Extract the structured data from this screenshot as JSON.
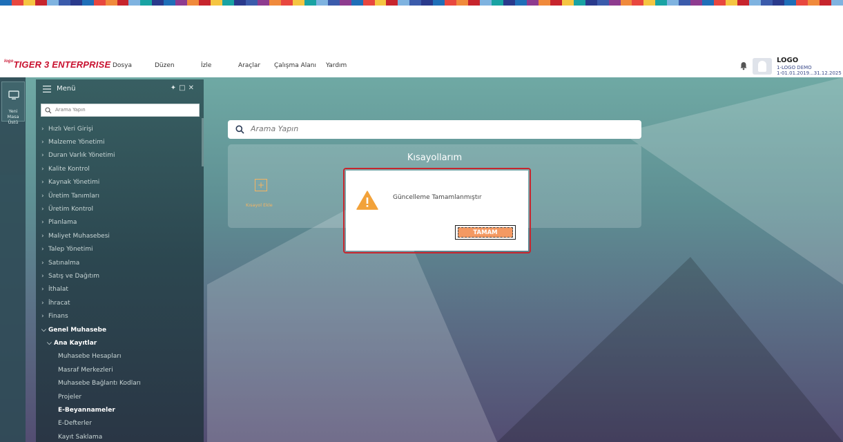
{
  "app": {
    "brand_prefix": "logo",
    "brand": "TIGER 3 ENTERPRISE"
  },
  "menubar": {
    "items": [
      {
        "label": "Dosya"
      },
      {
        "label": "Düzen"
      },
      {
        "label": "İzle"
      },
      {
        "label": "Araçlar"
      },
      {
        "label": "Çalışma Alanı"
      },
      {
        "label": "Yardım"
      }
    ]
  },
  "user": {
    "name": "LOGO",
    "company": "1-LOGO DEMO",
    "period": "1-01.01.2019...31.12.2025"
  },
  "leftbar": {
    "new_desktop_label": "Yeni Masa Üstü"
  },
  "menu_panel": {
    "title": "Menü",
    "search_placeholder": "Arama Yapın",
    "items": [
      {
        "label": "Hızlı Veri Girişi",
        "chev": ">"
      },
      {
        "label": "Malzeme Yönetimi",
        "chev": ">"
      },
      {
        "label": "Duran Varlık Yönetimi",
        "chev": ">"
      },
      {
        "label": "Kalite Kontrol",
        "chev": ">"
      },
      {
        "label": "Kaynak Yönetimi",
        "chev": ">"
      },
      {
        "label": "Üretim Tanımları",
        "chev": ">"
      },
      {
        "label": "Üretim Kontrol",
        "chev": ">"
      },
      {
        "label": "Planlama",
        "chev": ">"
      },
      {
        "label": "Maliyet Muhasebesi",
        "chev": ">"
      },
      {
        "label": "Talep Yönetimi",
        "chev": ">"
      },
      {
        "label": "Satınalma",
        "chev": ">"
      },
      {
        "label": "Satış ve Dağıtım",
        "chev": ">"
      },
      {
        "label": "İthalat",
        "chev": ">"
      },
      {
        "label": "İhracat",
        "chev": ">"
      },
      {
        "label": "Finans",
        "chev": ">"
      },
      {
        "label": "Genel Muhasebe",
        "chev": "v"
      },
      {
        "label": "Ana Kayıtlar",
        "chev": "v"
      },
      {
        "label": "Muhasebe Hesapları"
      },
      {
        "label": "Masraf Merkezleri"
      },
      {
        "label": "Muhasebe Bağlantı Kodları"
      },
      {
        "label": "Projeler"
      },
      {
        "label": "E-Beyannameler"
      },
      {
        "label": "E-Defterler"
      },
      {
        "label": "Kayıt Saklama"
      }
    ]
  },
  "main": {
    "search_placeholder": "Arama Yapın",
    "shortcuts_title": "Kısayollarım",
    "shortcut_add_label": "Kısayol Ekle"
  },
  "dialog": {
    "message": "Güncelleme Tamamlanmıştır",
    "ok_label": "TAMAM"
  },
  "colors": {
    "brand_red": "#c8102e",
    "accent_orange": "#f49962",
    "highlight_red": "#c7252d"
  }
}
